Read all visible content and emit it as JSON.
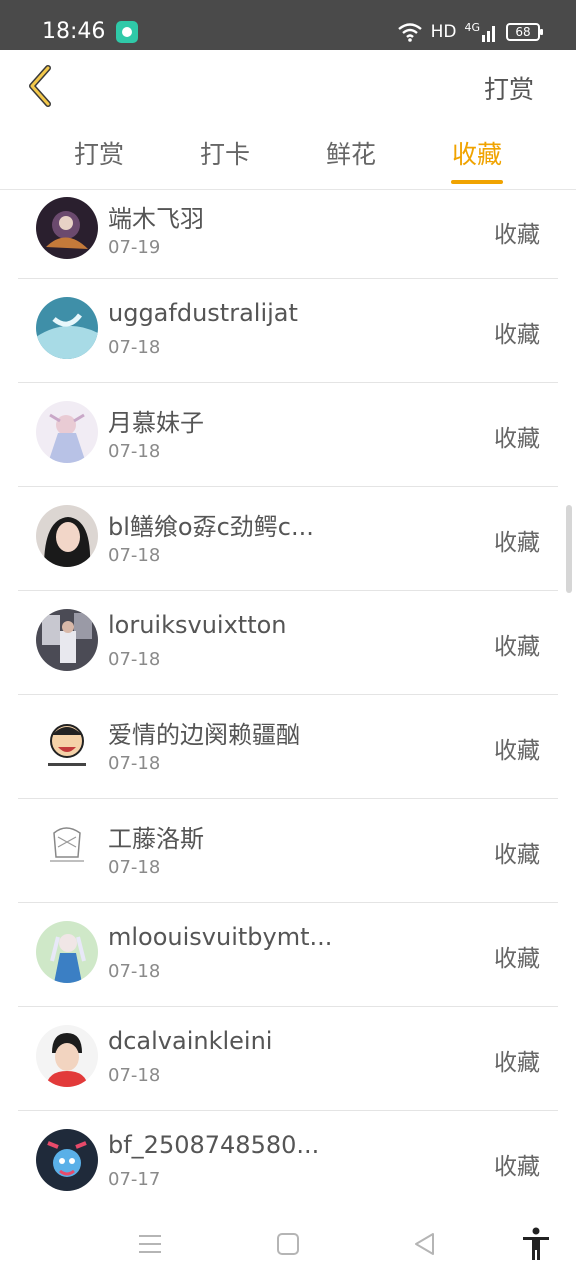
{
  "status_bar": {
    "time": "18:46",
    "network": "HD",
    "signal_label": "4G",
    "battery": "68"
  },
  "header": {
    "back_icon": "chevron-left-icon",
    "action_label": "打赏"
  },
  "tabs": [
    {
      "label": "打赏",
      "active": false
    },
    {
      "label": "打卡",
      "active": false
    },
    {
      "label": "鲜花",
      "active": false
    },
    {
      "label": "收藏",
      "active": true
    }
  ],
  "items": [
    {
      "name": "端木飞羽",
      "date": "07-19",
      "action": "收藏"
    },
    {
      "name": "uggafdustralijat",
      "date": "07-18",
      "action": "收藏"
    },
    {
      "name": "月慕妹子",
      "date": "07-18",
      "action": "收藏"
    },
    {
      "name": "bl鳝飨o孬c劲鳄c...",
      "date": "07-18",
      "action": "收藏"
    },
    {
      "name": "loruiksvuixtton",
      "date": "07-18",
      "action": "收藏"
    },
    {
      "name": "爱情的边阕赖疆酗",
      "date": "07-18",
      "action": "收藏"
    },
    {
      "name": "工藤洛斯",
      "date": "07-18",
      "action": "收藏"
    },
    {
      "name": "mloouisvuitbymt...",
      "date": "07-18",
      "action": "收藏"
    },
    {
      "name": "dcalvainkleini",
      "date": "07-18",
      "action": "收藏"
    },
    {
      "name": "bf_2508748580...",
      "date": "07-17",
      "action": "收藏"
    }
  ],
  "nav_bar": {
    "icons": [
      "menu-icon",
      "home-square-icon",
      "back-triangle-icon",
      "accessibility-icon"
    ]
  },
  "colors": {
    "accent": "#f0a300",
    "status_bar": "#4a4a4a",
    "divider": "#e4e4e4"
  }
}
